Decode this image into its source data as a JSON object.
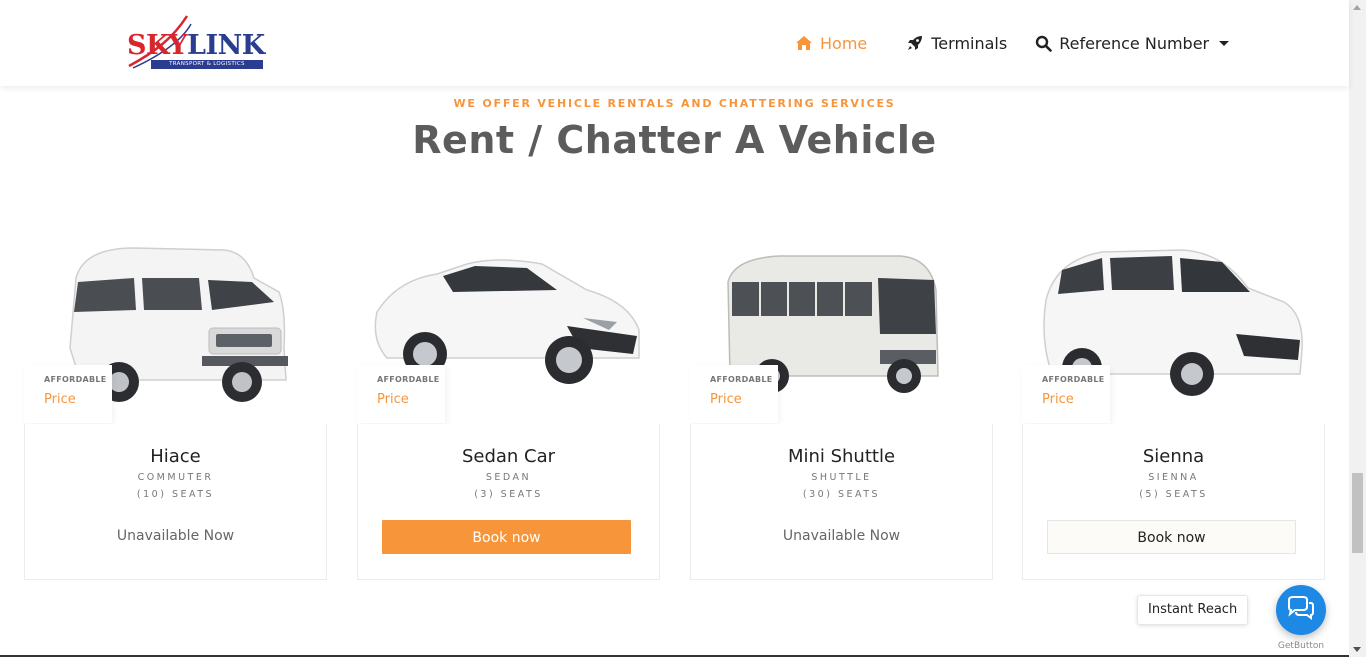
{
  "header": {
    "logo": {
      "word1": "SKY",
      "word2": "LINK",
      "tagline": "TRANSPORT & LOGISTICS"
    },
    "nav": {
      "home": "Home",
      "terminals": "Terminals",
      "reference": "Reference Number"
    }
  },
  "section": {
    "eyebrow": "WE OFFER VEHICLE RENTALS AND CHATTERING SERVICES",
    "title": "Rent / Chatter A Vehicle"
  },
  "vehicles": [
    {
      "badge_small": "AFFORDABLE",
      "badge_price": "Price",
      "name": "Hiace",
      "type": "COMMUTER",
      "seats": "(10) SEATS",
      "status": "Unavailable Now",
      "icon": "van-image"
    },
    {
      "badge_small": "AFFORDABLE",
      "badge_price": "Price",
      "name": "Sedan Car",
      "type": "SEDAN",
      "seats": "(3) SEATS",
      "button": "Book now",
      "icon": "sedan-image"
    },
    {
      "badge_small": "AFFORDABLE",
      "badge_price": "Price",
      "name": "Mini Shuttle",
      "type": "SHUTTLE",
      "seats": "(30) SEATS",
      "status": "Unavailable Now",
      "icon": "bus-image"
    },
    {
      "badge_small": "AFFORDABLE",
      "badge_price": "Price",
      "name": "Sienna",
      "type": "SIENNA",
      "seats": "(5) SEATS",
      "button": "Book now",
      "icon": "minivan-image"
    }
  ],
  "widget": {
    "label": "Instant Reach",
    "brand": "GetButton"
  },
  "colors": {
    "accent": "#f7953b",
    "chat": "#1e88e5",
    "heading": "#5c5c5c"
  }
}
